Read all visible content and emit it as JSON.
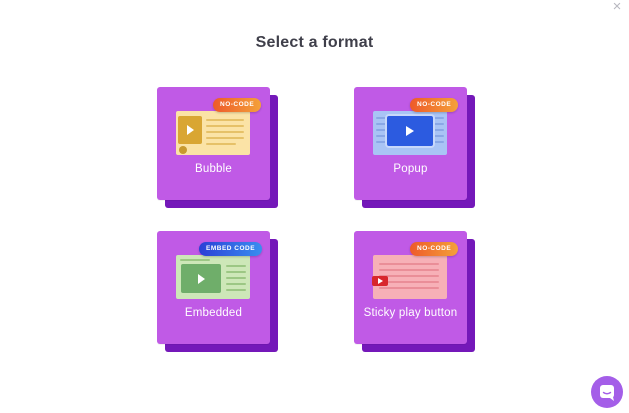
{
  "modal": {
    "title": "Select a format",
    "close_glyph": "×"
  },
  "formats": [
    {
      "label": "Bubble",
      "badge": "NO-CODE",
      "icon": "bubble-illustration-icon"
    },
    {
      "label": "Popup",
      "badge": "NO-CODE",
      "icon": "popup-illustration-icon"
    },
    {
      "label": "Embedded",
      "badge": "EMBED CODE",
      "icon": "embedded-illustration-icon"
    },
    {
      "label": "Sticky play button",
      "badge": "NO-CODE",
      "icon": "sticky-play-illustration-icon"
    }
  ],
  "colors": {
    "card_front": "#c05ae6",
    "card_shadow": "#7418b9",
    "badge_no_code": "#f07a33",
    "badge_embed": "#2f6ae6",
    "chat_button": "#a45ee8"
  },
  "chat": {
    "icon": "chat-bubble-icon"
  }
}
